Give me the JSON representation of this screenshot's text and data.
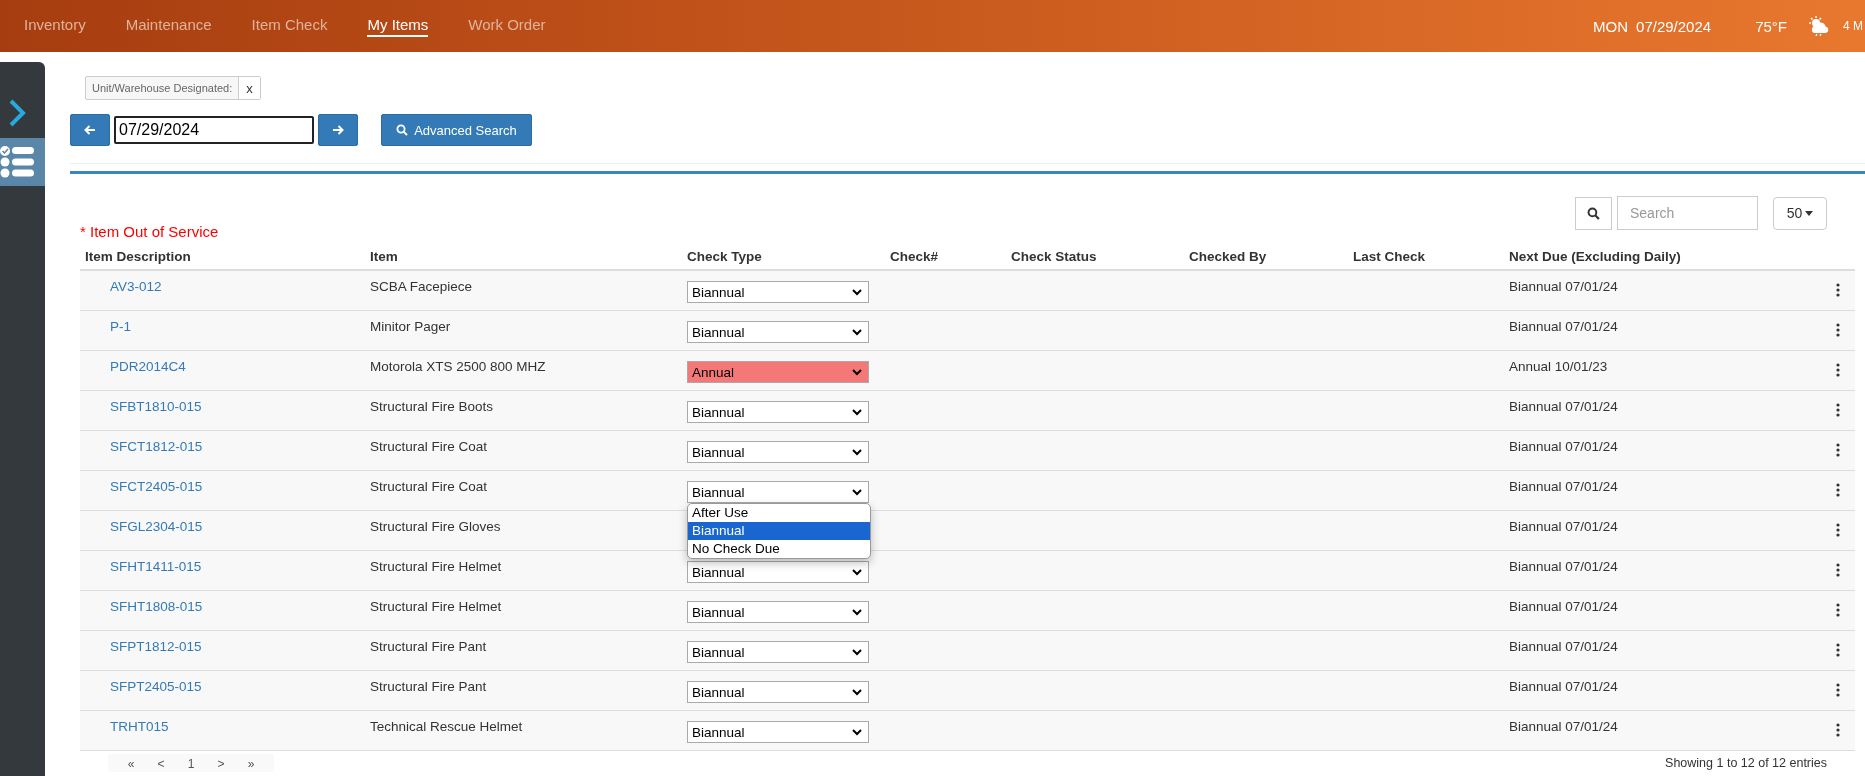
{
  "nav": {
    "items": [
      {
        "label": "Inventory",
        "selected": false
      },
      {
        "label": "Maintenance",
        "selected": false
      },
      {
        "label": "Item Check",
        "selected": false
      },
      {
        "label": "My Items",
        "selected": true
      },
      {
        "label": "Work Order",
        "selected": false
      }
    ],
    "day": "MON",
    "date": "07/29/2024",
    "temperature": "75°F",
    "extra": "4 M"
  },
  "filter_tag": {
    "label": "Unit/Warehouse Designated:",
    "remove": "x"
  },
  "date_field": {
    "value": "07/29/2024"
  },
  "advanced_search": "Advanced Search",
  "search": {
    "placeholder": "Search"
  },
  "page_size": "50",
  "legend": "* Item Out of Service",
  "table": {
    "columns": [
      "Item Description",
      "Item",
      "Check Type",
      "Check#",
      "Check Status",
      "Checked By",
      "Last Check",
      "Next Due (Excluding Daily)"
    ],
    "rows": [
      {
        "id": "AV3-012",
        "item": "SCBA Facepiece",
        "check_type": "Biannual",
        "out_of_service": false,
        "next_due": "Biannual 07/01/24"
      },
      {
        "id": "P-1",
        "item": "Minitor Pager",
        "check_type": "Biannual",
        "out_of_service": false,
        "next_due": "Biannual 07/01/24"
      },
      {
        "id": "PDR2014C4",
        "item": "Motorola XTS 2500 800 MHZ",
        "check_type": "Annual",
        "out_of_service": true,
        "next_due": "Annual 10/01/23"
      },
      {
        "id": "SFBT1810-015",
        "item": "Structural Fire Boots",
        "check_type": "Biannual",
        "out_of_service": false,
        "next_due": "Biannual 07/01/24"
      },
      {
        "id": "SFCT1812-015",
        "item": "Structural Fire Coat",
        "check_type": "Biannual",
        "out_of_service": false,
        "next_due": "Biannual 07/01/24"
      },
      {
        "id": "SFCT2405-015",
        "item": "Structural Fire Coat",
        "check_type": "Biannual",
        "out_of_service": false,
        "next_due": "Biannual 07/01/24",
        "open_menu": [
          {
            "label": "After Use",
            "selected": false
          },
          {
            "label": "Biannual",
            "selected": true
          },
          {
            "label": "No Check Due",
            "selected": false
          }
        ]
      },
      {
        "id": "SFGL2304-015",
        "item": "Structural Fire Gloves",
        "next_due": "Biannual 07/01/24"
      },
      {
        "id": "SFHT1411-015",
        "item": "Structural Fire Helmet",
        "check_type": "Biannual",
        "out_of_service": false,
        "next_due": "Biannual 07/01/24"
      },
      {
        "id": "SFHT1808-015",
        "item": "Structural Fire Helmet",
        "check_type": "Biannual",
        "out_of_service": false,
        "next_due": "Biannual 07/01/24"
      },
      {
        "id": "SFPT1812-015",
        "item": "Structural Fire Pant",
        "check_type": "Biannual",
        "out_of_service": false,
        "next_due": "Biannual 07/01/24"
      },
      {
        "id": "SFPT2405-015",
        "item": "Structural Fire Pant",
        "check_type": "Biannual",
        "out_of_service": false,
        "next_due": "Biannual 07/01/24"
      },
      {
        "id": "TRHT015",
        "item": "Technical Rescue Helmet",
        "check_type": "Biannual",
        "out_of_service": false,
        "next_due": "Biannual 07/01/24"
      }
    ]
  },
  "pagination": {
    "buttons": [
      "«",
      "<",
      "1",
      ">",
      "»"
    ],
    "summary": "Showing 1 to 12 of 12 entries"
  }
}
